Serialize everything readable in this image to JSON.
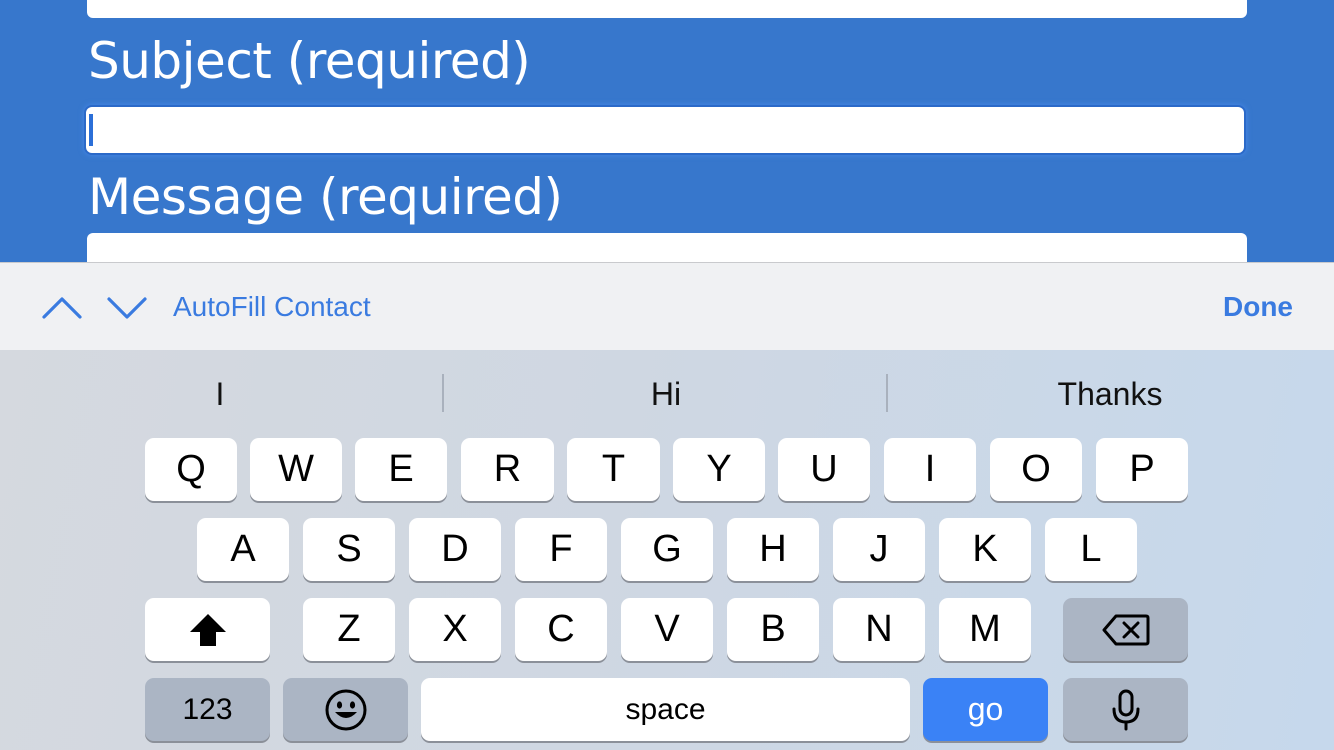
{
  "form": {
    "subject_label": "Subject (required)",
    "message_label": "Message (required)",
    "subject_value": "",
    "message_value": ""
  },
  "accessory": {
    "prev_icon": "chevron-up-icon",
    "next_icon": "chevron-down-icon",
    "autofill_label": "AutoFill Contact",
    "done_label": "Done",
    "accent_color": "#3a7be0"
  },
  "suggestions": [
    "I",
    "Hi",
    "Thanks"
  ],
  "keyboard": {
    "row1": [
      "Q",
      "W",
      "E",
      "R",
      "T",
      "Y",
      "U",
      "I",
      "O",
      "P"
    ],
    "row2": [
      "A",
      "S",
      "D",
      "F",
      "G",
      "H",
      "J",
      "K",
      "L"
    ],
    "row3": [
      "Z",
      "X",
      "C",
      "V",
      "B",
      "N",
      "M"
    ],
    "shift_icon": "shift-icon",
    "delete_icon": "backspace-icon",
    "numbers_label": "123",
    "emoji_icon": "emoji-icon",
    "space_label": "space",
    "go_label": "go",
    "mic_icon": "microphone-icon",
    "go_color": "#3a82f6"
  }
}
